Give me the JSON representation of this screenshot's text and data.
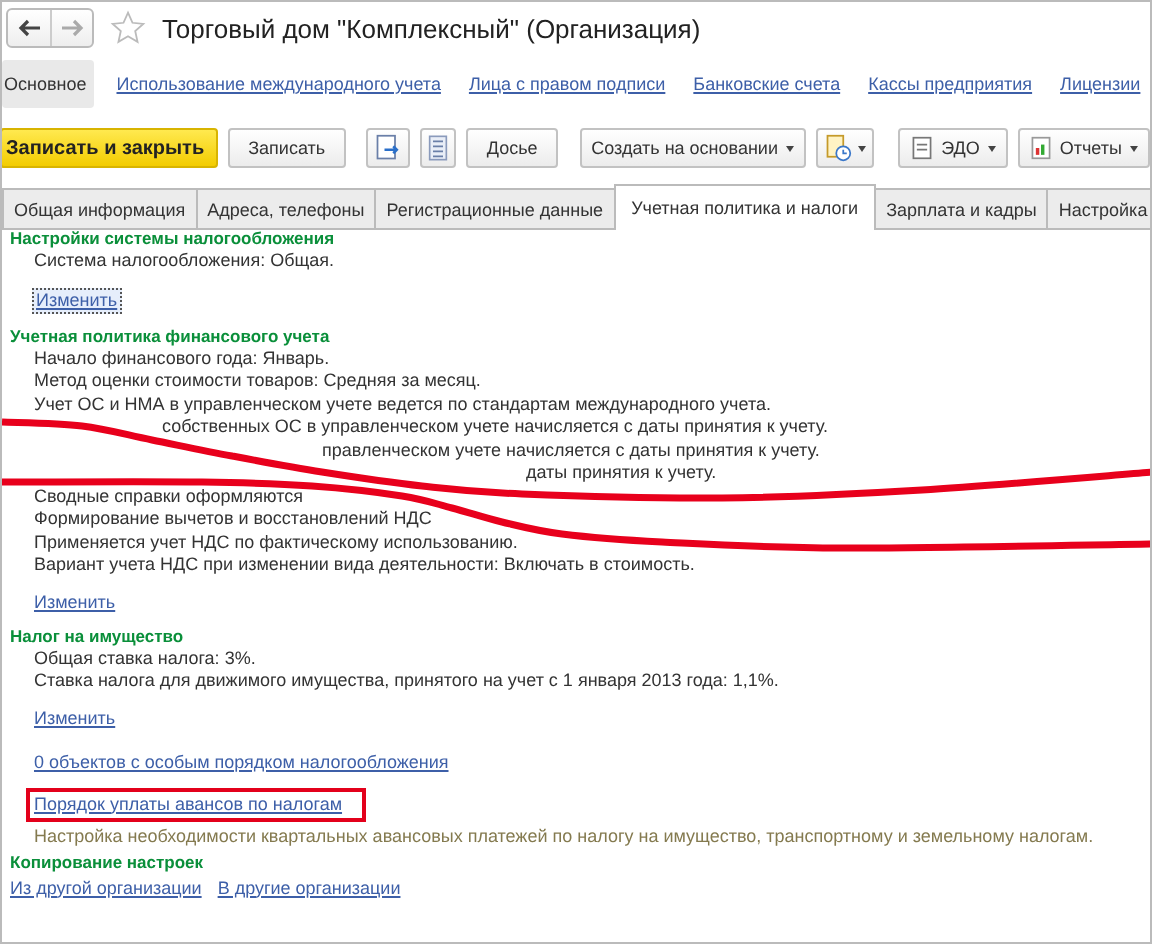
{
  "window": {
    "title": "Торговый дом \"Комплексный\" (Организация)"
  },
  "nav": [
    {
      "label": "Основное",
      "selected": true
    },
    {
      "label": "Использование международного учета",
      "selected": false
    },
    {
      "label": "Лица с правом подписи",
      "selected": false
    },
    {
      "label": "Банковские счета",
      "selected": false
    },
    {
      "label": "Кассы предприятия",
      "selected": false
    },
    {
      "label": "Лицензии",
      "selected": false
    }
  ],
  "toolbar": [
    {
      "kind": "primary",
      "label": "Записать и закрыть"
    },
    {
      "kind": "text",
      "label": "Записать"
    },
    {
      "kind": "icon"
    },
    {
      "kind": "icon"
    },
    {
      "kind": "text",
      "label": "Досье"
    },
    {
      "kind": "menu",
      "label": "Создать на основании"
    },
    {
      "kind": "icon-menu"
    },
    {
      "kind": "menu",
      "label": "ЭДО"
    },
    {
      "kind": "menu",
      "label": "Отчеты"
    }
  ],
  "tabs": [
    {
      "label": "Общая информация",
      "selected": false
    },
    {
      "label": "Адреса, телефоны",
      "selected": false
    },
    {
      "label": "Регистрационные данные",
      "selected": false
    },
    {
      "label": "Учетная политика и налоги",
      "selected": true
    },
    {
      "label": "Зарплата и кадры",
      "selected": false
    },
    {
      "label": "Настройка",
      "selected": false
    }
  ],
  "sections": [
    {
      "heading": "Настройки системы налогообложения",
      "items": [
        {
          "kind": "text",
          "text": "Система налогообложения: Общая."
        },
        {
          "kind": "link",
          "text": "Изменить",
          "focused": true
        }
      ]
    },
    {
      "heading": "Учетная политика финансового учета",
      "items": [
        {
          "kind": "text",
          "text": "Начало финансового года: Январь."
        },
        {
          "kind": "text",
          "text": "Метод оценки стоимости товаров: Средняя за месяц."
        },
        {
          "kind": "text",
          "text": "Учет ОС и НМА в управленческом учете ведется по стандартам международного учета."
        },
        {
          "kind": "fragment",
          "text": "собственных ОС в управленческом учете начисляется с даты принятия к учету."
        },
        {
          "kind": "fragment",
          "text": "правленческом учете начисляется с даты принятия к учету."
        },
        {
          "kind": "fragment",
          "text": "даты принятия к учету."
        },
        {
          "kind": "text",
          "text": "Сводные справки оформляются"
        },
        {
          "kind": "text",
          "text": "Формирование вычетов и восстановлений НДС"
        },
        {
          "kind": "text",
          "text": "Применяется учет НДС по фактическому использованию."
        },
        {
          "kind": "text",
          "text": "Вариант учета НДС при изменении вида деятельности: Включать в стоимость."
        },
        {
          "kind": "link",
          "text": "Изменить",
          "focused": false
        }
      ]
    },
    {
      "heading": "Налог на имущество",
      "items": [
        {
          "kind": "text",
          "text": "Общая ставка налога: 3%."
        },
        {
          "kind": "text",
          "text": "Ставка налога для движимого имущества, принятого на учет с 1 января 2013 года: 1,1%."
        },
        {
          "kind": "link",
          "text": "Изменить",
          "focused": false
        },
        {
          "kind": "link",
          "text": "0 объектов с особым порядком налогообложения",
          "focused": false
        },
        {
          "kind": "link",
          "text": "Порядок уплаты авансов по налогам",
          "focused": false,
          "highlighted": true
        },
        {
          "kind": "note",
          "text": "Настройка необходимости квартальных авансовых платежей по налогу на имущество, транспортному и земельному налогам."
        }
      ]
    },
    {
      "heading": "Копирование настроек",
      "items": [
        {
          "kind": "links",
          "links": [
            "Из другой организации",
            "В другие организации"
          ]
        }
      ]
    }
  ]
}
